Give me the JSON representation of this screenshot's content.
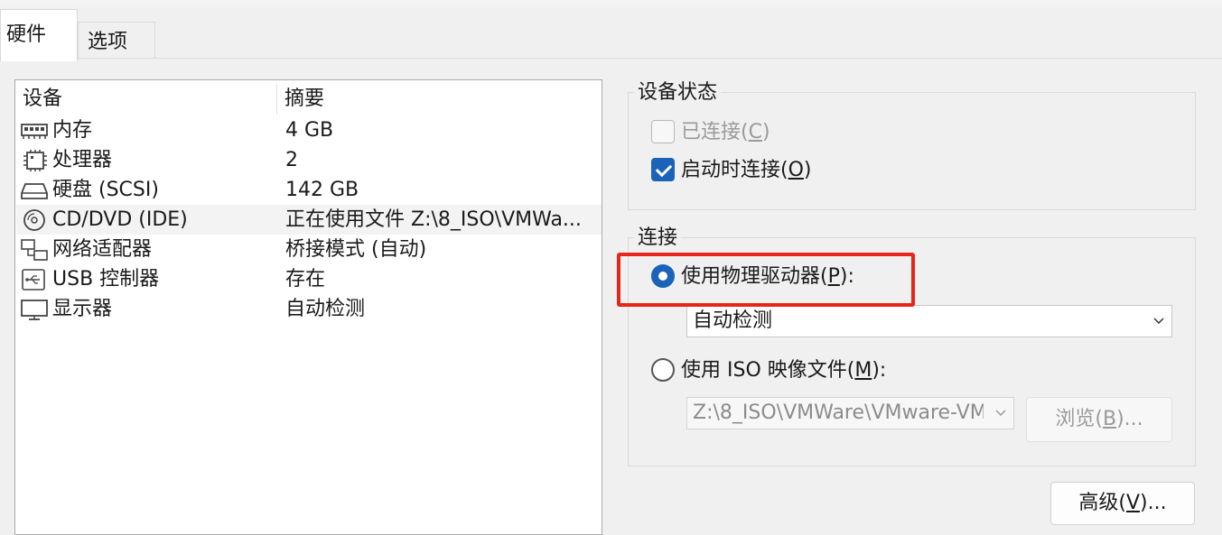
{
  "tabs": [
    {
      "label": "硬件",
      "active": true
    },
    {
      "label": "选项",
      "active": false
    }
  ],
  "device_list": {
    "headers": {
      "device": "设备",
      "summary": "摘要"
    },
    "rows": [
      {
        "icon": "memory-icon",
        "name": "内存",
        "summary": "4 GB",
        "selected": false
      },
      {
        "icon": "processor-icon",
        "name": "处理器",
        "summary": "2",
        "selected": false
      },
      {
        "icon": "hard-disk-icon",
        "name": "硬盘 (SCSI)",
        "summary": "142 GB",
        "selected": false
      },
      {
        "icon": "cd-dvd-icon",
        "name": "CD/DVD (IDE)",
        "summary": "正在使用文件 Z:\\8_ISO\\VMWa...",
        "selected": true
      },
      {
        "icon": "network-adapter-icon",
        "name": "网络适配器",
        "summary": "桥接模式 (自动)",
        "selected": false
      },
      {
        "icon": "usb-controller-icon",
        "name": "USB 控制器",
        "summary": "存在",
        "selected": false
      },
      {
        "icon": "display-icon",
        "name": "显示器",
        "summary": "自动检测",
        "selected": false
      }
    ]
  },
  "device_status": {
    "title": "设备状态",
    "connected": {
      "label": "已连接(",
      "key": "C",
      "suffix": ")",
      "checked": false,
      "enabled": false
    },
    "connect_at_power_on": {
      "label": "启动时连接(",
      "key": "O",
      "suffix": ")",
      "checked": true,
      "enabled": true
    }
  },
  "connection": {
    "title": "连接",
    "physical_drive": {
      "label": "使用物理驱动器(",
      "key": "P",
      "suffix": "):",
      "selected": true
    },
    "physical_drive_select": {
      "value": "自动检测"
    },
    "iso_file": {
      "label": "使用 ISO 映像文件(",
      "key": "M",
      "suffix": "):",
      "selected": false
    },
    "iso_path": {
      "value": "Z:\\8_ISO\\VMWare\\VMware-VM"
    },
    "browse_button": {
      "label": "浏览(",
      "key": "B",
      "suffix": ")..."
    }
  },
  "advanced_button": {
    "label": "高级(",
    "key": "V",
    "suffix": ")..."
  },
  "colors": {
    "accent": "#1a63b8",
    "highlight_border": "#e8251a",
    "panel_bg": "#f0f0f0"
  }
}
